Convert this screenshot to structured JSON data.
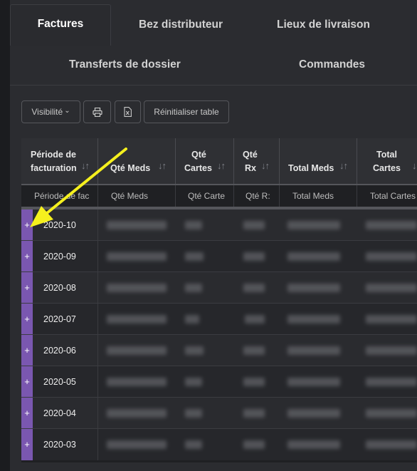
{
  "tabs": {
    "row1": [
      {
        "label": "Factures",
        "active": true
      },
      {
        "label": "Bez distributeur",
        "active": false
      },
      {
        "label": "Lieux de livraison",
        "active": false
      }
    ],
    "row2": [
      {
        "label": "Transferts de dossier",
        "active": false
      },
      {
        "label": "Commandes",
        "active": false
      }
    ]
  },
  "toolbar": {
    "visibility_label": "Visibilité",
    "visibility_caret": "⌄",
    "print_icon": "printer-icon",
    "excel_icon": "excel-file-icon",
    "reset_label": "Réinitialiser table"
  },
  "table": {
    "headers": [
      {
        "line1": "Période de",
        "line2": "facturation"
      },
      {
        "line1": "Qté Meds",
        "line2": ""
      },
      {
        "line1": "Qté",
        "line2": "Cartes"
      },
      {
        "line1": "Qté",
        "line2": "Rx"
      },
      {
        "line1": "Total Meds",
        "line2": ""
      },
      {
        "line1": "Total",
        "line2": "Cartes"
      }
    ],
    "sort_icon": "↓↑",
    "filters": [
      "Période de fac",
      "Qté Meds",
      "Qté Carte",
      "Qté R:",
      "Total Meds",
      "Total Cartes"
    ],
    "expander_symbol": "+",
    "rows": [
      "2020-10",
      "2020-09",
      "2020-08",
      "2020-07",
      "2020-06",
      "2020-05",
      "2020-04",
      "2020-03"
    ]
  },
  "colors": {
    "accent_purple": "#7a57b0",
    "annotation_arrow": "#f5f01e",
    "background": "#2b2c30"
  }
}
